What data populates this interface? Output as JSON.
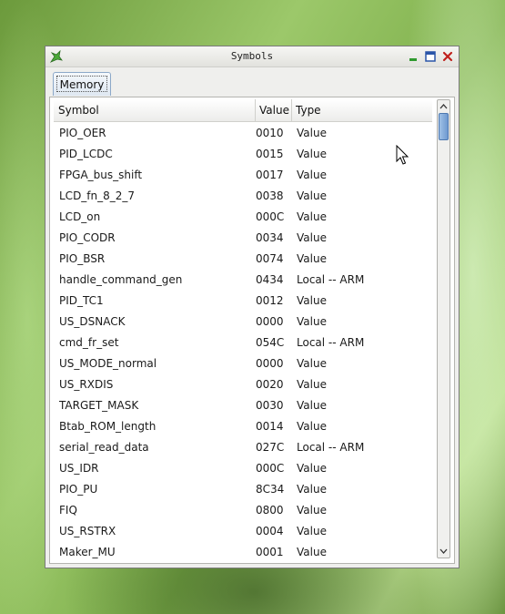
{
  "window": {
    "title": "Symbols"
  },
  "tabs": [
    {
      "label": "Memory",
      "selected": true
    }
  ],
  "table": {
    "columns": {
      "symbol": "Symbol",
      "value": "Value",
      "type": "Type"
    },
    "rows": [
      {
        "symbol": "PIO_OER",
        "value": "0010",
        "type": "Value"
      },
      {
        "symbol": "PID_LCDC",
        "value": "0015",
        "type": "Value"
      },
      {
        "symbol": "FPGA_bus_shift",
        "value": "0017",
        "type": "Value"
      },
      {
        "symbol": "LCD_fn_8_2_7",
        "value": "0038",
        "type": "Value"
      },
      {
        "symbol": "LCD_on",
        "value": "000C",
        "type": "Value"
      },
      {
        "symbol": "PIO_CODR",
        "value": "0034",
        "type": "Value"
      },
      {
        "symbol": "PIO_BSR",
        "value": "0074",
        "type": "Value"
      },
      {
        "symbol": "handle_command_gen",
        "value": "0434",
        "type": "Local -- ARM"
      },
      {
        "symbol": "PID_TC1",
        "value": "0012",
        "type": "Value"
      },
      {
        "symbol": "US_DSNACK",
        "value": "0000",
        "type": "Value"
      },
      {
        "symbol": "cmd_fr_set",
        "value": "054C",
        "type": "Local -- ARM"
      },
      {
        "symbol": "US_MODE_normal",
        "value": "0000",
        "type": "Value"
      },
      {
        "symbol": "US_RXDIS",
        "value": "0020",
        "type": "Value"
      },
      {
        "symbol": "TARGET_MASK",
        "value": "0030",
        "type": "Value"
      },
      {
        "symbol": "Btab_ROM_length",
        "value": "0014",
        "type": "Value"
      },
      {
        "symbol": "serial_read_data",
        "value": "027C",
        "type": "Local -- ARM"
      },
      {
        "symbol": "US_IDR",
        "value": "000C",
        "type": "Value"
      },
      {
        "symbol": "PIO_PU",
        "value": "8C34",
        "type": "Value"
      },
      {
        "symbol": "FIQ",
        "value": "0800",
        "type": "Value"
      },
      {
        "symbol": "US_RSTRX",
        "value": "0004",
        "type": "Value"
      },
      {
        "symbol": "Maker_MU",
        "value": "0001",
        "type": "Value"
      }
    ]
  },
  "icons": {
    "app": "app-icon",
    "minimize": "minimize-icon",
    "maximize": "maximize-icon",
    "close": "close-icon",
    "scroll_up": "chevron-up-icon",
    "scroll_down": "chevron-down-icon",
    "cursor": "mouse-pointer-icon"
  },
  "colors": {
    "accent": "#6f9ad0",
    "close_red": "#c0201c",
    "minimize_green": "#2f9a2f",
    "maximize_blue": "#2a55a8"
  }
}
